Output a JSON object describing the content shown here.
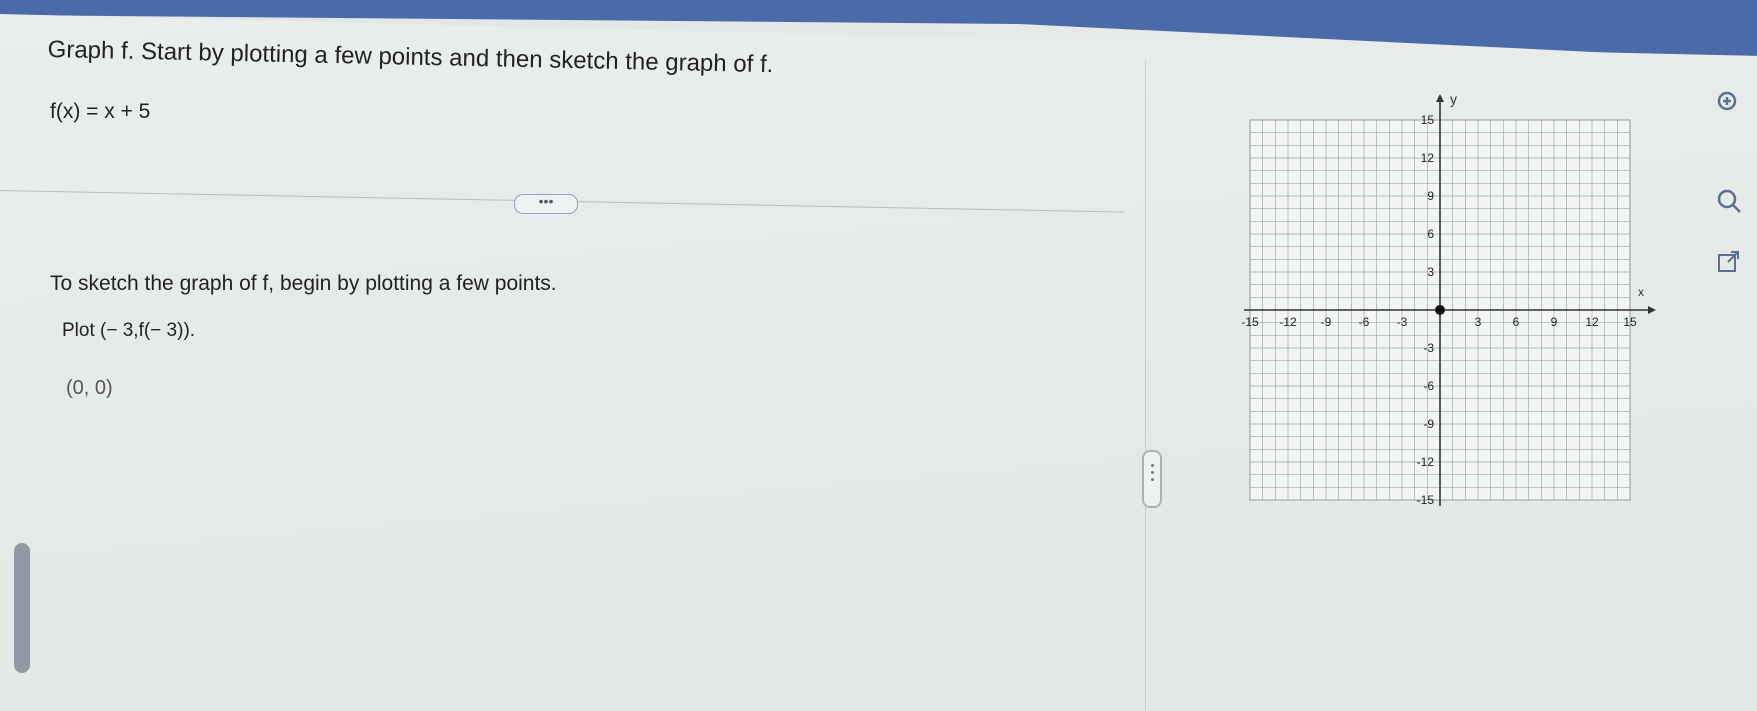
{
  "question": {
    "title": "Graph f. Start by plotting a few points and then sketch the graph of f.",
    "function": "f(x) = x + 5",
    "instruction": "To sketch the graph of f, begin by plotting a few points.",
    "plot_prompt": "Plot (− 3,f(− 3)).",
    "answer_point": "(0, 0)",
    "more_button": "•••"
  },
  "graph": {
    "x_label": "x",
    "y_label": "y",
    "x_ticks": [
      "-15",
      "-12",
      "-9",
      "-6",
      "-3",
      "3",
      "6",
      "9",
      "12",
      "15"
    ],
    "y_ticks": [
      "15",
      "12",
      "9",
      "6",
      "3",
      "-3",
      "-6",
      "-9",
      "-12",
      "-15"
    ],
    "range": [
      -15,
      15
    ],
    "plotted_point": [
      0,
      0
    ]
  },
  "icons": {
    "zoom_in": "zoom-in-icon",
    "zoom_out": "zoom-out-icon",
    "popout": "popout-icon"
  }
}
